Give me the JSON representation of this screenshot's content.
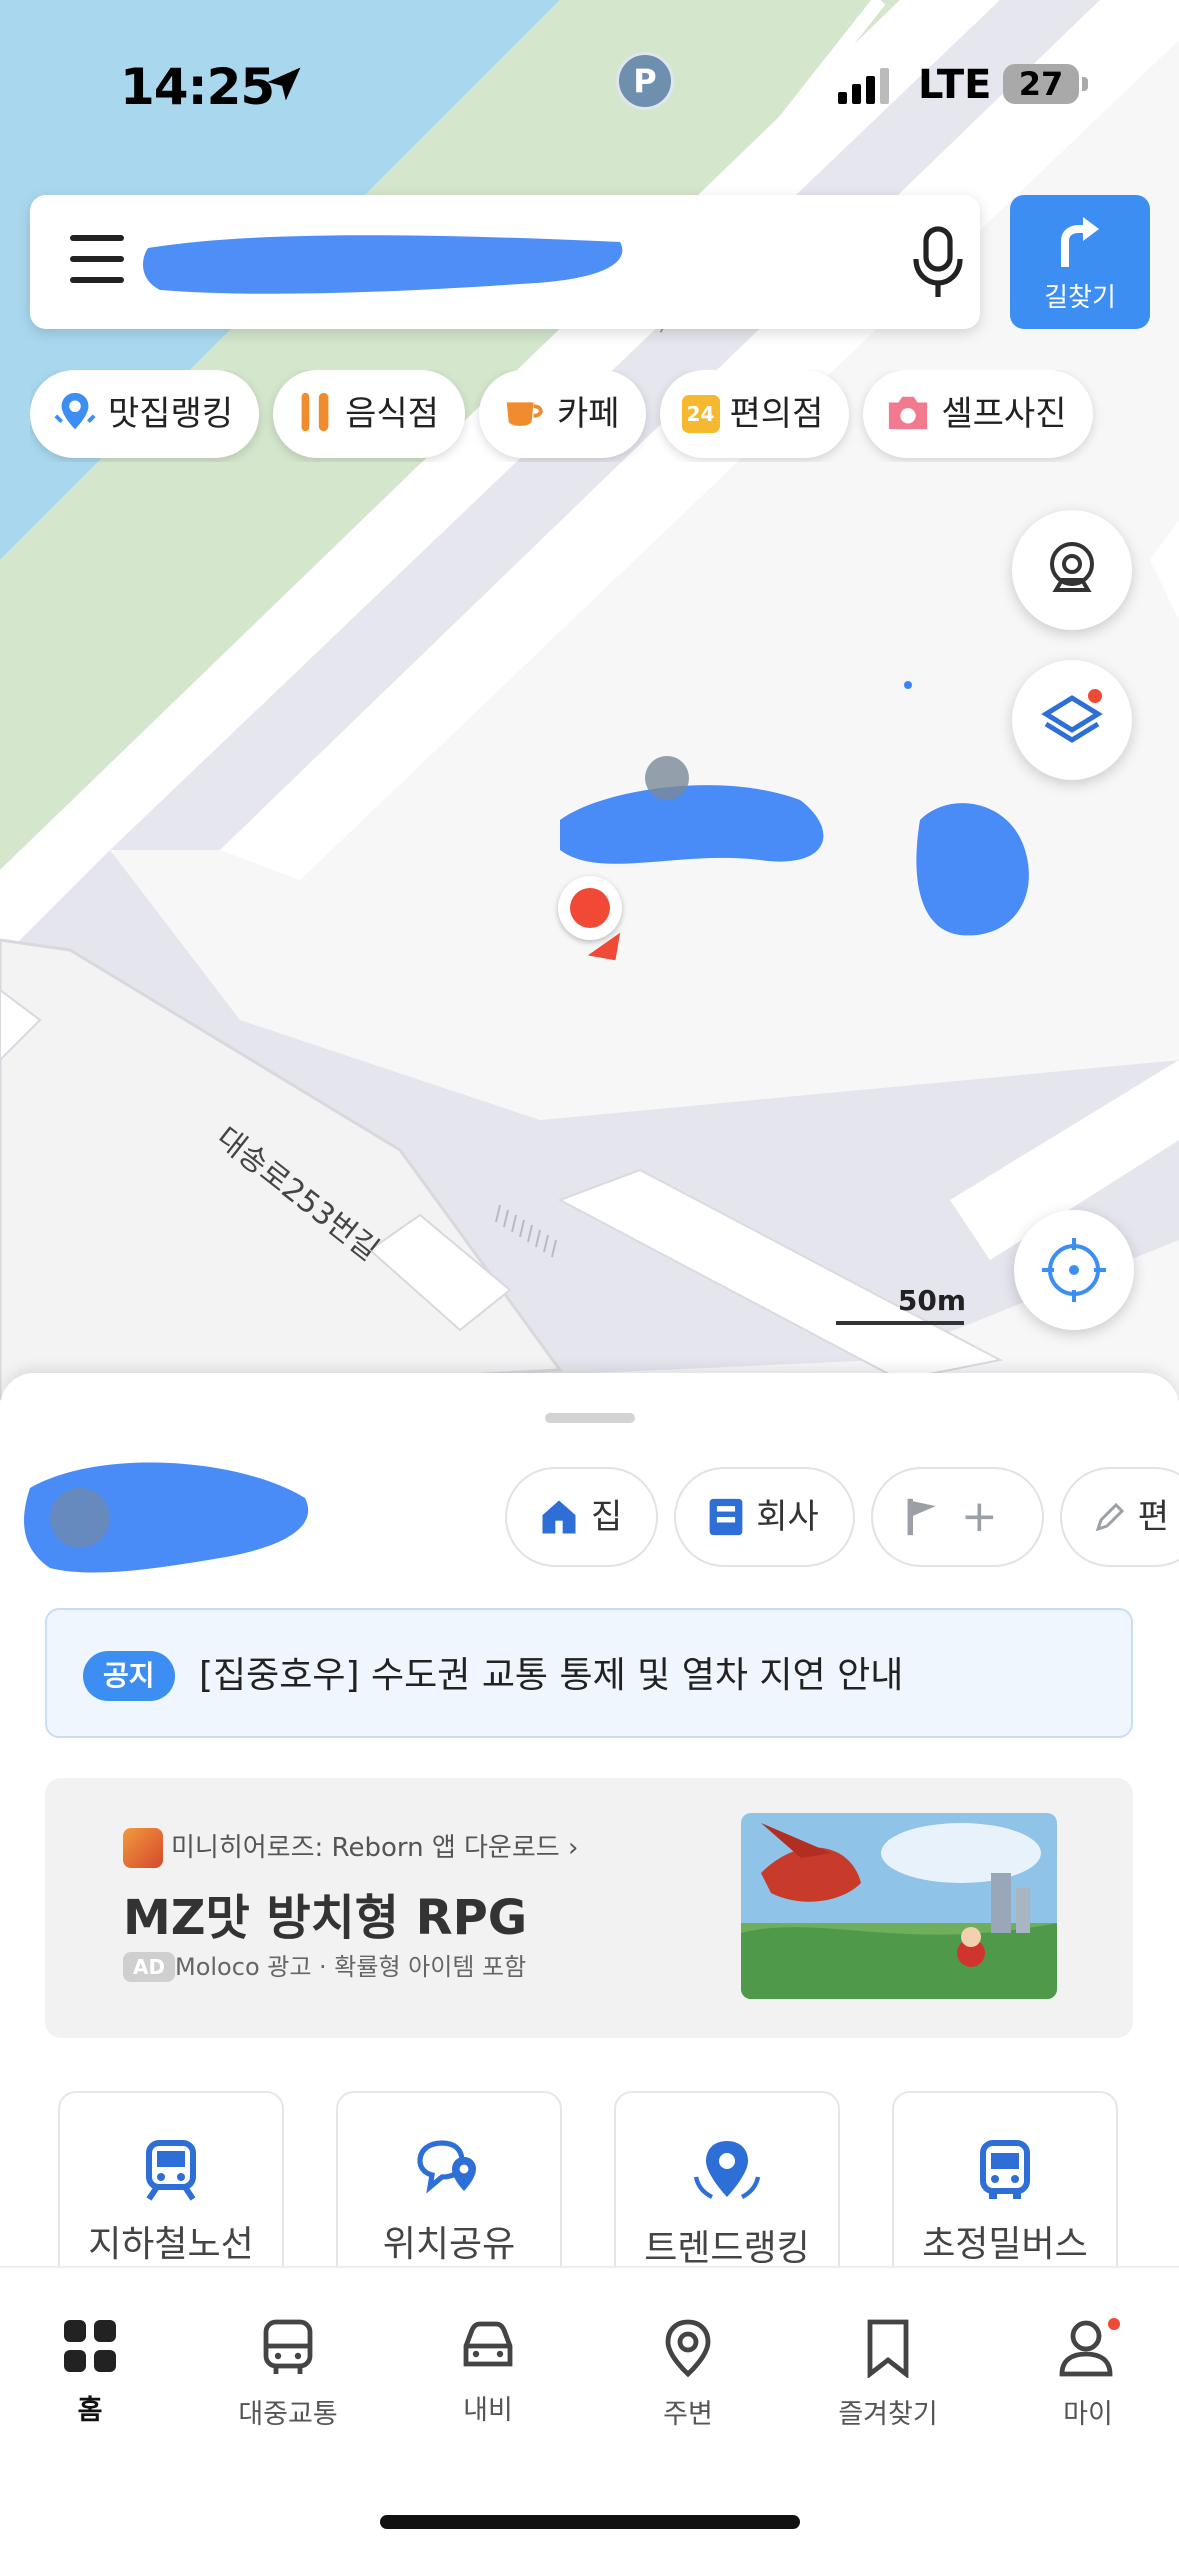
{
  "status_bar": {
    "time": "14:25",
    "parking_badge": "P",
    "network": "LTE",
    "battery": "27"
  },
  "search": {
    "placeholder": "",
    "route_label": "길찾기"
  },
  "categories": [
    {
      "label": "맛집랭킹",
      "icon": "ranking-pin-icon"
    },
    {
      "label": "음식점",
      "icon": "utensils-icon"
    },
    {
      "label": "카페",
      "icon": "coffee-cup-icon"
    },
    {
      "label": "편의점",
      "icon": "convenience-24-icon",
      "icon_text": "24"
    },
    {
      "label": "셀프사진",
      "icon": "camera-icon"
    }
  ],
  "map": {
    "road_label": "대송로253번길",
    "scale_label": "50m",
    "colors": {
      "water": "#a9d8ee",
      "park": "#d4e6cc",
      "road": "#ffffff",
      "block": "#e5e5ee"
    }
  },
  "quick_places": [
    {
      "label": "집",
      "icon": "home-icon"
    },
    {
      "label": "회사",
      "icon": "office-icon"
    },
    {
      "label": "",
      "icon": "flag-add-icon",
      "extra": "+"
    },
    {
      "label": "편",
      "icon": "edit-pencil-icon"
    }
  ],
  "notice": {
    "badge": "공지",
    "text": "[집중호우] 수도권 교통 통제 및 열차 지연 안내"
  },
  "ad": {
    "app_line": "미니히어로즈: Reborn 앱 다운로드 ›",
    "headline": "MZ맛 방치형 RPG",
    "tag": "AD",
    "meta": "Moloco 광고 · 확률형 아이템 포함"
  },
  "shortcuts": [
    {
      "label": "지하철노선",
      "icon": "subway-icon"
    },
    {
      "label": "위치공유",
      "icon": "location-share-icon"
    },
    {
      "label": "트렌드랭킹",
      "icon": "trend-ranking-icon"
    },
    {
      "label": "초정밀버스",
      "icon": "bus-icon"
    }
  ],
  "tabs": [
    {
      "label": "홈",
      "icon": "home-grid-icon",
      "active": true
    },
    {
      "label": "대중교통",
      "icon": "bus-outline-icon"
    },
    {
      "label": "내비",
      "icon": "car-icon"
    },
    {
      "label": "주변",
      "icon": "pin-outline-icon"
    },
    {
      "label": "즐겨찾기",
      "icon": "bookmark-icon"
    },
    {
      "label": "마이",
      "icon": "person-icon",
      "badge_dot": true
    }
  ],
  "accent_color": "#3d8ef3"
}
